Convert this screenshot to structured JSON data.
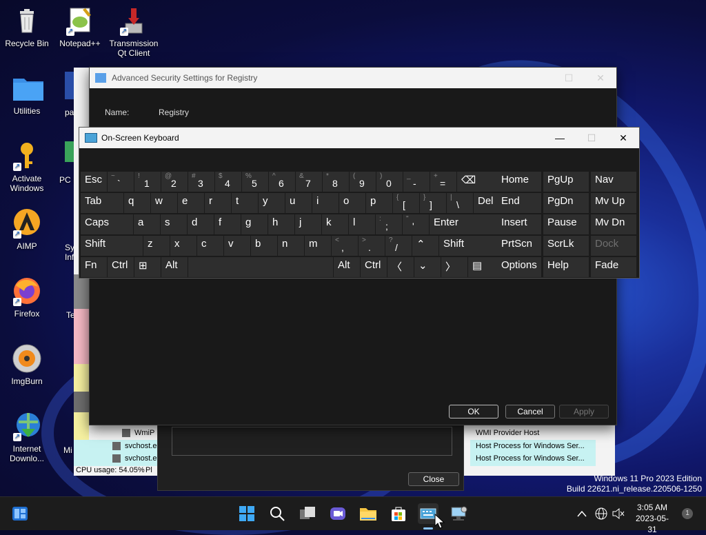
{
  "desktop": {
    "icons": [
      {
        "label": "Recycle Bin"
      },
      {
        "label": "Notepad++"
      },
      {
        "label": "Transmission Qt Client"
      },
      {
        "label": "Utilities"
      },
      {
        "label": "Activate Windows"
      },
      {
        "label": "AIMP"
      },
      {
        "label": "Firefox"
      },
      {
        "label": "ImgBurn"
      },
      {
        "label": "Internet Downlo..."
      }
    ],
    "partial_labels": [
      "pai",
      "PC M",
      "Sy",
      "Inf",
      "Te",
      "Mi"
    ],
    "watermark": {
      "line1": "Windows 11 Pro 2023 Edition",
      "line2": "Build 22621.ni_release.220506-1250"
    }
  },
  "task_manager": {
    "rows": [
      "WmiP",
      "svchost.e",
      "svchost.e"
    ],
    "right_rows": [
      "WMI Provider Host",
      "Host Process for Windows Ser...",
      "Host Process for Windows Ser..."
    ],
    "cpu_usage": "CPU usage: 54.05%",
    "partial": "Pl"
  },
  "advanced_security": {
    "title": "Advanced Security Settings for Registry",
    "name_label": "Name:",
    "name_value": "Registry",
    "ok": "OK",
    "cancel": "Cancel",
    "apply": "Apply"
  },
  "properties": {
    "close": "Close"
  },
  "osk": {
    "title": "On-Screen Keyboard",
    "rows": [
      [
        {
          "main": "Esc"
        },
        {
          "shift": "~",
          "main": "`"
        },
        {
          "shift": "!",
          "main": "1"
        },
        {
          "shift": "@",
          "main": "2"
        },
        {
          "shift": "#",
          "main": "3"
        },
        {
          "shift": "$",
          "main": "4"
        },
        {
          "shift": "%",
          "main": "5"
        },
        {
          "shift": "^",
          "main": "6"
        },
        {
          "shift": "&",
          "main": "7"
        },
        {
          "shift": "*",
          "main": "8"
        },
        {
          "shift": "(",
          "main": "9"
        },
        {
          "shift": ")",
          "main": "0"
        },
        {
          "shift": "_",
          "main": "-"
        },
        {
          "shift": "+",
          "main": "="
        },
        {
          "main": "⌫"
        }
      ],
      [
        {
          "main": "Tab"
        },
        {
          "main": "q"
        },
        {
          "main": "w"
        },
        {
          "main": "e"
        },
        {
          "main": "r"
        },
        {
          "main": "t"
        },
        {
          "main": "y"
        },
        {
          "main": "u"
        },
        {
          "main": "i"
        },
        {
          "main": "o"
        },
        {
          "main": "p"
        },
        {
          "shift": "{",
          "main": "["
        },
        {
          "shift": "}",
          "main": "]"
        },
        {
          "shift": "|",
          "main": "\\"
        },
        {
          "main": "Del"
        }
      ],
      [
        {
          "main": "Caps"
        },
        {
          "main": "a"
        },
        {
          "main": "s"
        },
        {
          "main": "d"
        },
        {
          "main": "f"
        },
        {
          "main": "g"
        },
        {
          "main": "h"
        },
        {
          "main": "j"
        },
        {
          "main": "k"
        },
        {
          "main": "l"
        },
        {
          "shift": ":",
          "main": ";"
        },
        {
          "shift": "\"",
          "main": "'"
        },
        {
          "main": "Enter"
        }
      ],
      [
        {
          "main": "Shift"
        },
        {
          "main": "z"
        },
        {
          "main": "x"
        },
        {
          "main": "c"
        },
        {
          "main": "v"
        },
        {
          "main": "b"
        },
        {
          "main": "n"
        },
        {
          "main": "m"
        },
        {
          "shift": "<",
          "main": ","
        },
        {
          "shift": ">",
          "main": "."
        },
        {
          "shift": "?",
          "main": "/"
        },
        {
          "main": "⌃"
        },
        {
          "main": "Shift"
        }
      ],
      [
        {
          "main": "Fn"
        },
        {
          "main": "Ctrl"
        },
        {
          "main": "⊞"
        },
        {
          "main": "Alt"
        },
        {
          "main": ""
        },
        {
          "main": "Alt"
        },
        {
          "main": "Ctrl"
        },
        {
          "main": "〈"
        },
        {
          "main": "⌄"
        },
        {
          "main": "〉"
        },
        {
          "main": "▤"
        }
      ]
    ],
    "nav_keys": [
      [
        "Home",
        "PgUp",
        "Nav"
      ],
      [
        "End",
        "PgDn",
        "Mv Up"
      ],
      [
        "Insert",
        "Pause",
        "Mv Dn"
      ],
      [
        "PrtScn",
        "ScrLk",
        "Dock"
      ],
      [
        "Options",
        "Help",
        "Fade"
      ]
    ]
  },
  "taskbar": {
    "time": "3:05 AM",
    "date": "2023-05-31",
    "notification_count": "1"
  }
}
